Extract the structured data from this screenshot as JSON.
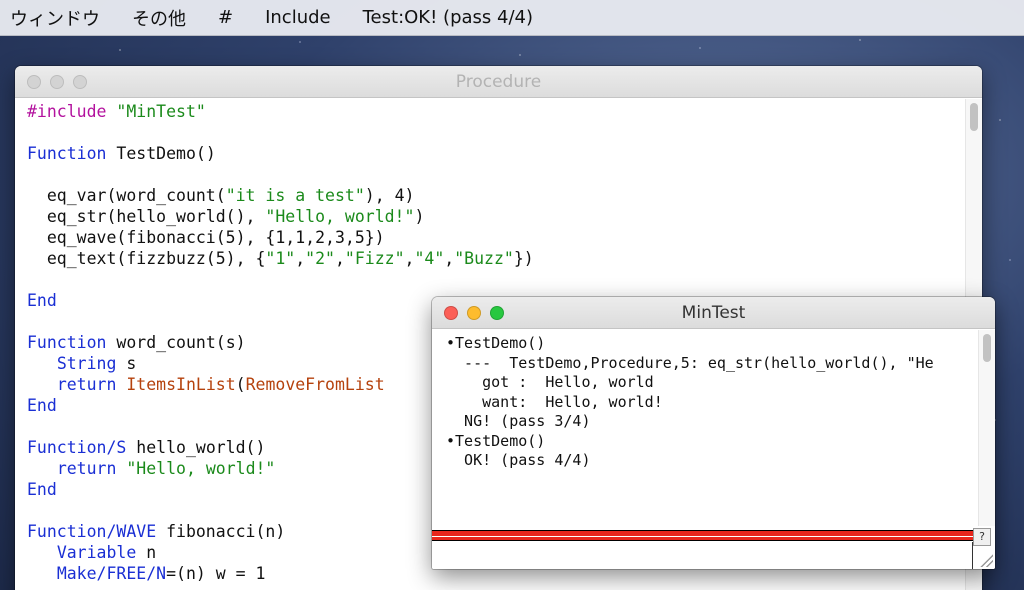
{
  "menubar": {
    "items": [
      "ウィンドウ",
      "その他",
      "#",
      "Include",
      "Test:OK! (pass 4/4)"
    ]
  },
  "procedure_window": {
    "title": "Procedure",
    "code_lines": [
      "#include \"MinTest\"",
      "",
      "Function TestDemo()",
      "",
      "  eq_var(word_count(\"it is a test\"), 4)",
      "  eq_str(hello_world(), \"Hello, world!\")",
      "  eq_wave(fibonacci(5), {1,1,2,3,5})",
      "  eq_text(fizzbuzz(5), {\"1\",\"2\",\"Fizz\",\"4\",\"Buzz\"})",
      "",
      "End",
      "",
      "Function word_count(s)",
      "   String s",
      "   return ItemsInList(RemoveFromList",
      "End",
      "",
      "Function/S hello_world()",
      "   return \"Hello, world!\"",
      "End",
      "",
      "Function/WAVE fibonacci(n)",
      "   Variable n",
      "   Make/FREE/N=(n) w = 1"
    ]
  },
  "mintest_window": {
    "title": "MinTest",
    "output_lines": [
      "•TestDemo()",
      "  ---  TestDemo,Procedure,5: eq_str(hello_world(), \"He",
      "    got :  Hello, world",
      "    want:  Hello, world!",
      "  NG! (pass 3/4)",
      "•TestDemo()",
      "  OK! (pass 4/4)"
    ],
    "help_button": "?"
  },
  "colors": {
    "keyword": "#1a2fd4",
    "string": "#1b8a1b",
    "preprocessor": "#b3129e",
    "builtin_function": "#b5420d",
    "close": "#fc5f57",
    "minimize": "#fdbc2e",
    "zoom": "#28c840",
    "red_bar": "#e8261c"
  }
}
